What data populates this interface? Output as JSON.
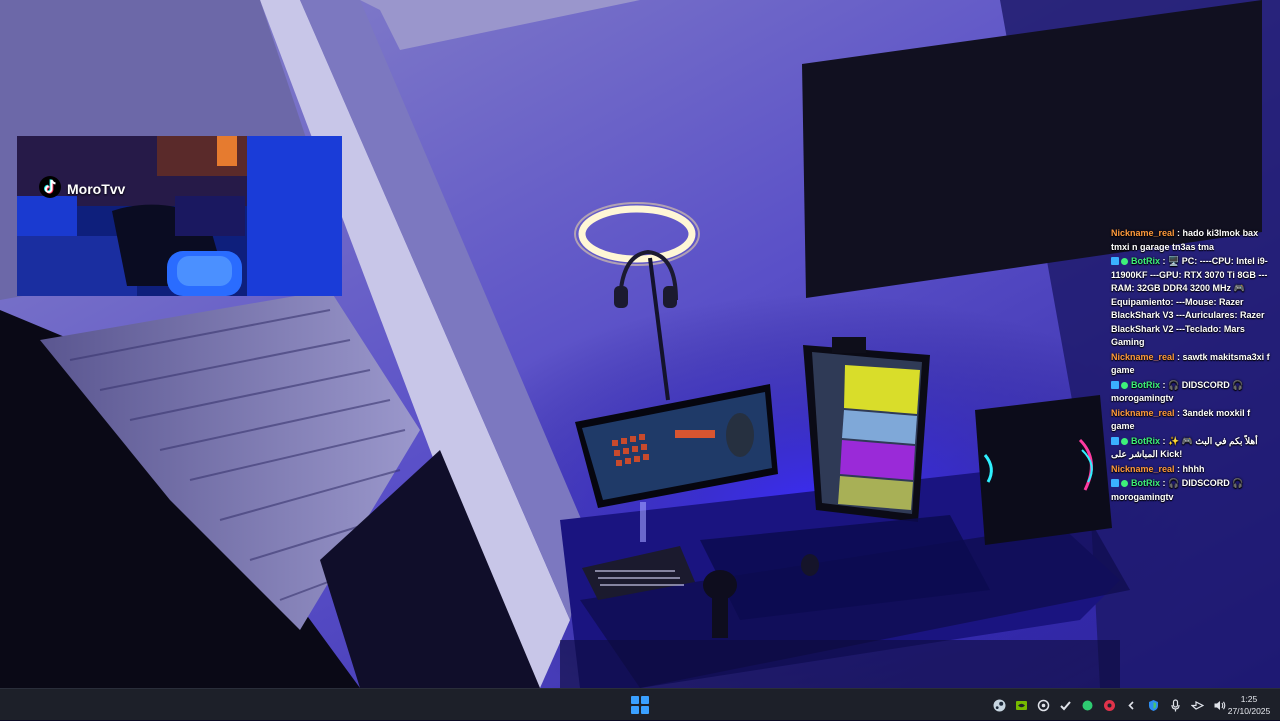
{
  "webcam": {
    "streamer_name": "MoroTvv",
    "platform_icon": "tiktok-icon"
  },
  "chat": {
    "messages": [
      {
        "user": "Nickname_real",
        "role": "viewer",
        "text": "hado ki3lmok bax tmxi n garage tn3as tma"
      },
      {
        "user": "BotRix",
        "role": "bot",
        "text": "🖥️ PC: ----CPU: Intel i9-11900KF ---GPU: RTX 3070 Ti 8GB ---RAM: 32GB DDR4 3200 MHz 🎮 Equipamiento: ---Mouse: Razer BlackShark V3 ---Auriculares: Razer BlackShark V2 ---Teclado: Mars Gaming"
      },
      {
        "user": "Nickname_real",
        "role": "viewer",
        "text": "sawtk makitsma3xi f game"
      },
      {
        "user": "BotRix",
        "role": "bot",
        "text": "🎧 DIDSCORD 🎧 morogamingtv"
      },
      {
        "user": "Nickname_real",
        "role": "viewer",
        "text": "3andek moxkil f game"
      },
      {
        "user": "BotRix",
        "role": "bot",
        "text": "✨ 🎮 أهلاً بكم في البث المباشر على Kick!"
      },
      {
        "user": "Nickname_real",
        "role": "viewer",
        "text": "hhhh"
      },
      {
        "user": "BotRix",
        "role": "bot",
        "text": "🎧 DIDSCORD 🎧 morogamingtv"
      }
    ]
  },
  "taskbar": {
    "start_icon": "windows-start-icon",
    "tray_icons": [
      "steam-icon",
      "nvidia-icon",
      "vpn-icon",
      "checkmark-icon",
      "green-status-icon",
      "red-app-icon",
      "chevron-left-icon",
      "shield-icon",
      "microphone-icon",
      "network-icon",
      "volume-icon"
    ],
    "time": "1:25",
    "date": "27/10/2025"
  },
  "colors": {
    "nick_viewer": "#ff9a3c",
    "nick_bot": "#3ef07a",
    "accent_blue": "#3aa0ff",
    "led_blue": "#2a1cff"
  }
}
